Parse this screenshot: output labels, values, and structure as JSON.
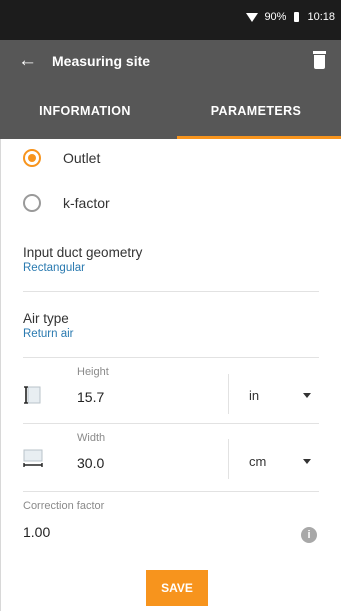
{
  "status_bar": {
    "battery": "90%",
    "time": "10:18"
  },
  "app_bar": {
    "title": "Measuring site"
  },
  "tabs": [
    {
      "label": "INFORMATION"
    },
    {
      "label": "PARAMETERS"
    }
  ],
  "options": {
    "outlet": {
      "label": "Outlet",
      "selected": true
    },
    "k_factor": {
      "label": "k-factor",
      "selected": false
    }
  },
  "duct_geometry": {
    "label": "Input duct geometry",
    "value": "Rectangular"
  },
  "air_type": {
    "label": "Air type",
    "value": "Return air"
  },
  "height": {
    "caption": "Height",
    "value": "15.7",
    "unit": "in"
  },
  "width": {
    "caption": "Width",
    "value": "30.0",
    "unit": "cm"
  },
  "correction_factor": {
    "caption": "Correction factor",
    "value": "1.00"
  },
  "save": {
    "label": "SAVE"
  },
  "colors": {
    "accent": "#f7941d",
    "app_bar": "#575757",
    "status_bar": "#1c1c1c",
    "link_value": "#2a7ab0"
  }
}
